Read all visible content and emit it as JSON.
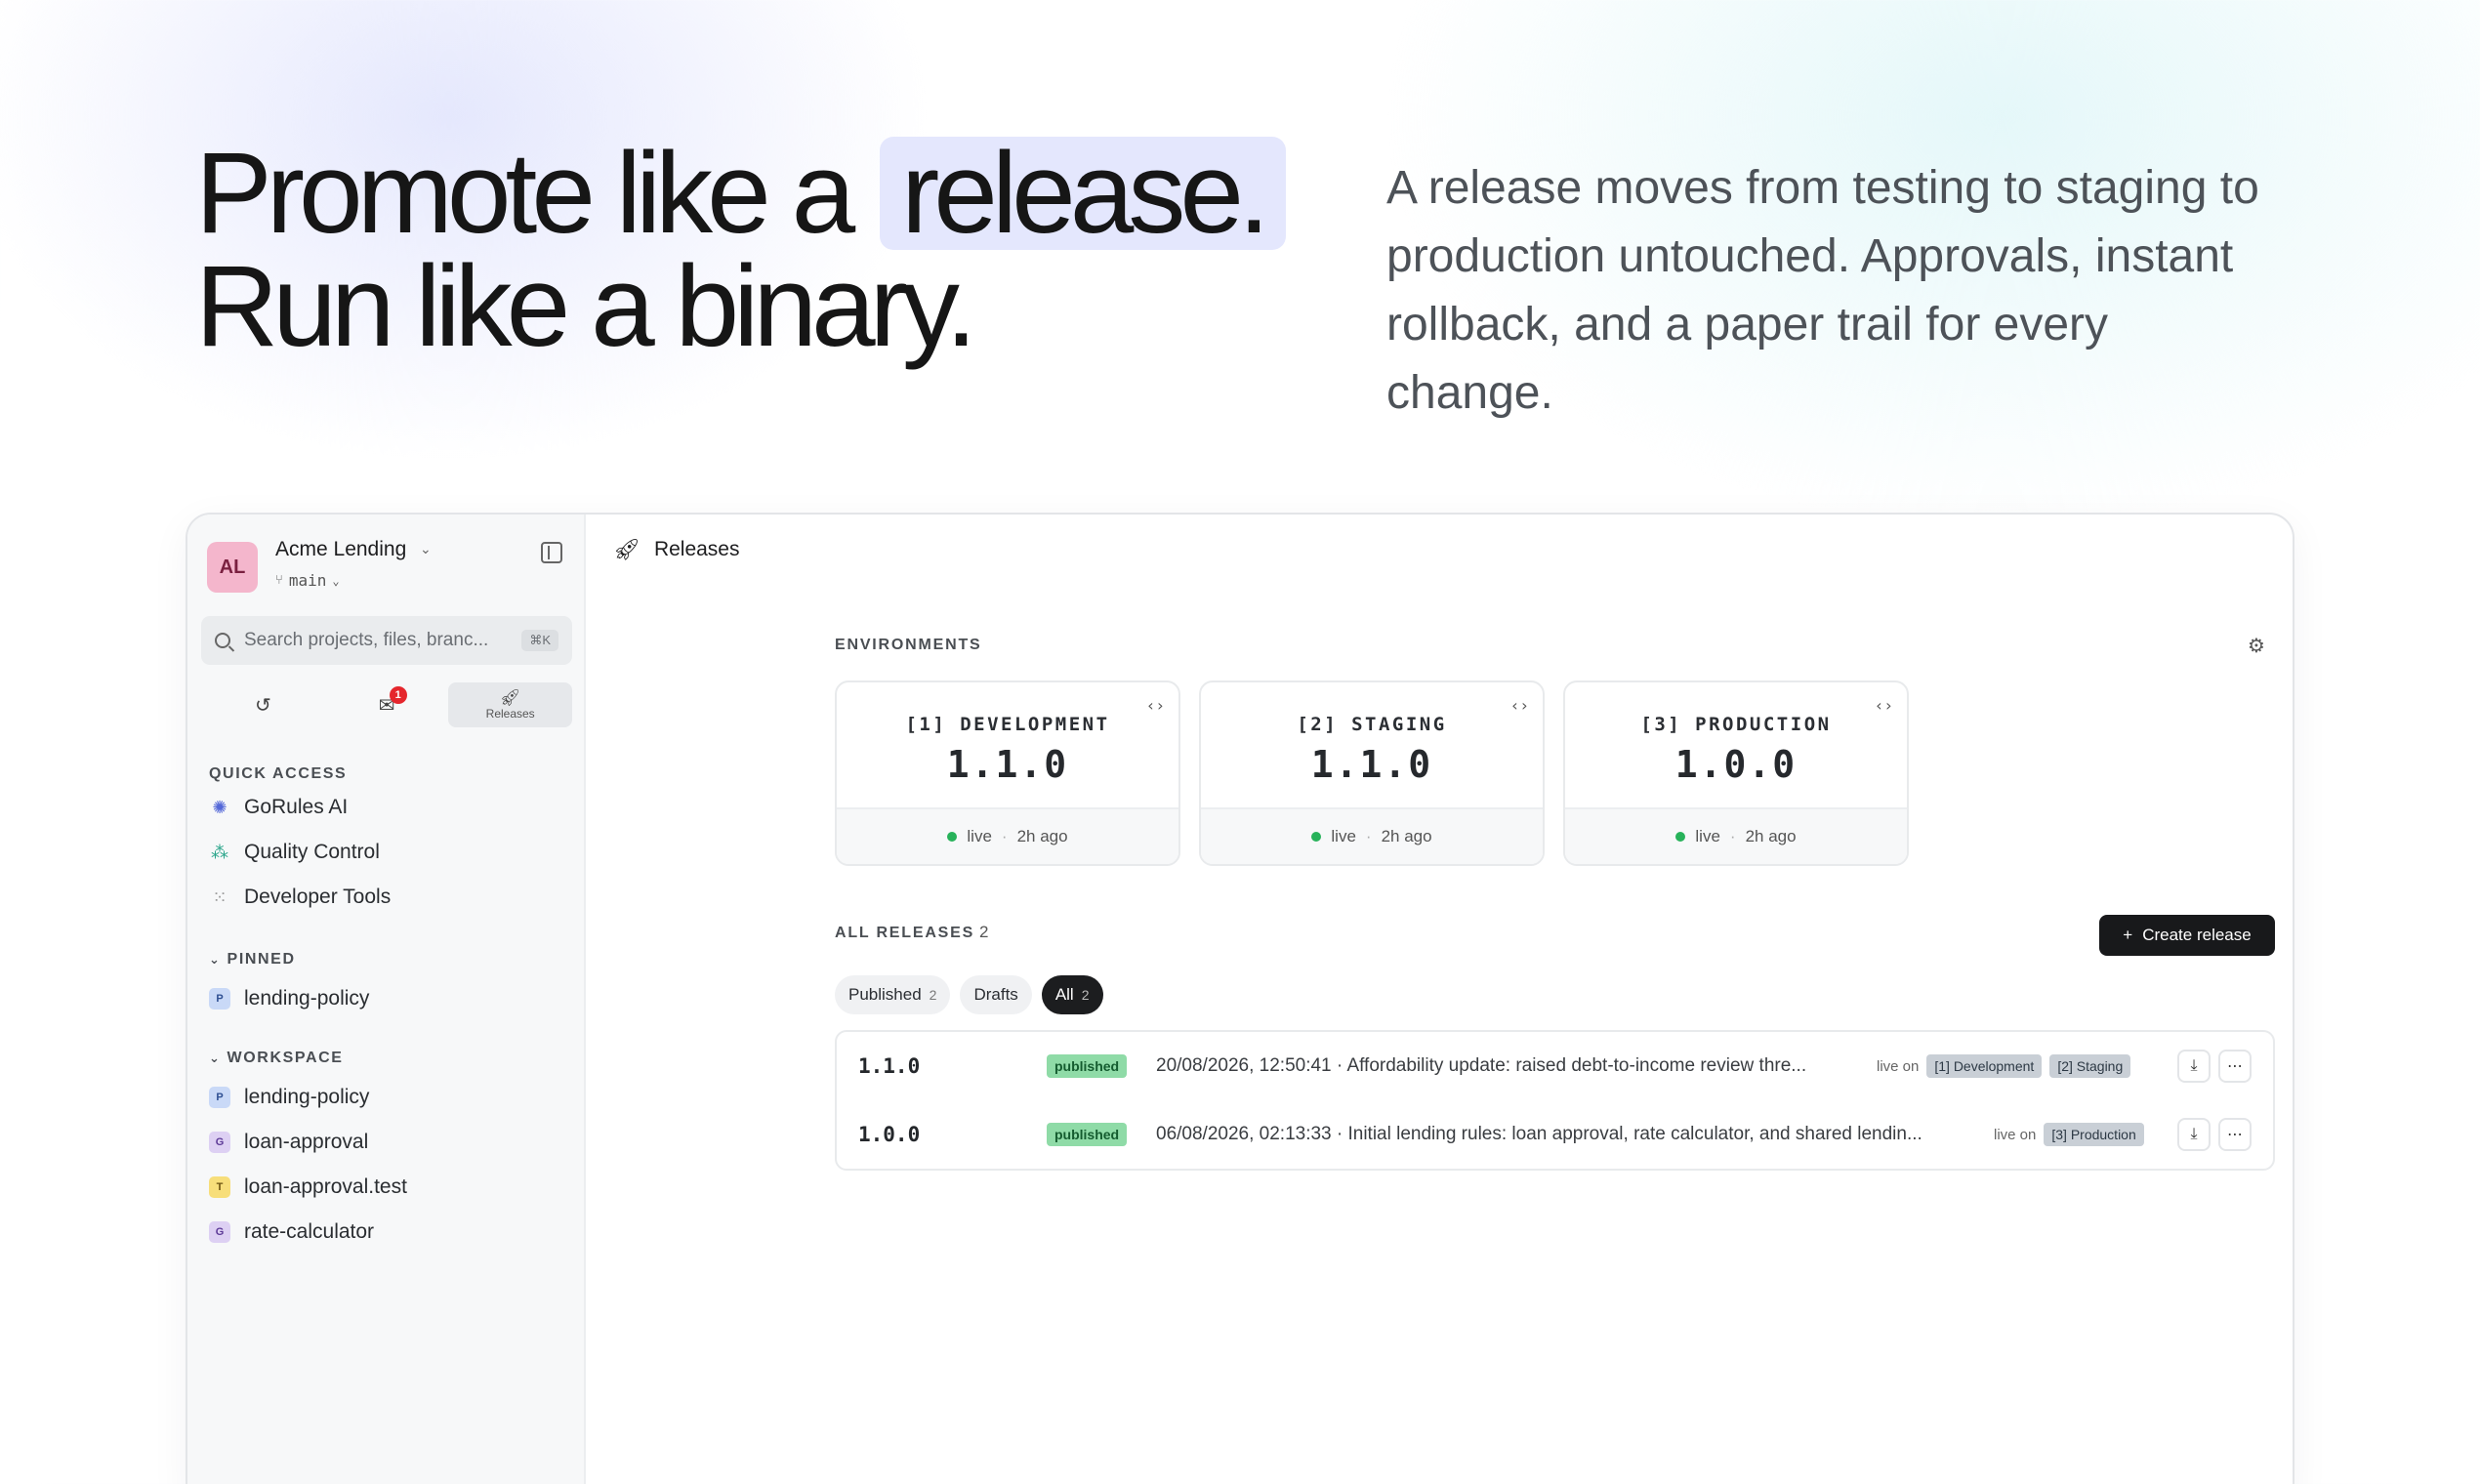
{
  "hero": {
    "title_line1_pre": "Promote like a",
    "title_line1_highlight": "release.",
    "title_line2": "Run like a binary.",
    "subtitle": "A release moves from testing to staging to production untouched. Approvals, instant rollback, and a paper trail for every change."
  },
  "sidebar": {
    "avatar": "AL",
    "org_name": "Acme Lending",
    "branch": "main",
    "search_placeholder": "Search projects, files, branc...",
    "search_shortcut": "⌘K",
    "notification_count": "1",
    "releases_tab_label": "Releases",
    "quick_access_title": "QUICK ACCESS",
    "quick_access": [
      "GoRules AI",
      "Quality Control",
      "Developer Tools"
    ],
    "pinned_title": "PINNED",
    "pinned": [
      {
        "chip": "P",
        "label": "lending-policy"
      }
    ],
    "workspace_title": "WORKSPACE",
    "workspace": [
      {
        "chip": "P",
        "label": "lending-policy"
      },
      {
        "chip": "G",
        "label": "loan-approval"
      },
      {
        "chip": "T",
        "label": "loan-approval.test"
      },
      {
        "chip": "G",
        "label": "rate-calculator"
      }
    ]
  },
  "main": {
    "page_title": "Releases",
    "environments_title": "ENVIRONMENTS",
    "environments": [
      {
        "name": "[1] DEVELOPMENT",
        "version": "1.1.0",
        "status": "live",
        "time": "2h ago"
      },
      {
        "name": "[2] STAGING",
        "version": "1.1.0",
        "status": "live",
        "time": "2h ago"
      },
      {
        "name": "[3] PRODUCTION",
        "version": "1.0.0",
        "status": "live",
        "time": "2h ago"
      }
    ],
    "all_releases_title": "ALL RELEASES",
    "all_releases_count": "2",
    "create_label": "Create release",
    "filters": [
      {
        "label": "Published",
        "count": "2"
      },
      {
        "label": "Drafts",
        "count": ""
      },
      {
        "label": "All",
        "count": "2"
      }
    ],
    "releases": [
      {
        "version": "1.1.0",
        "status": "published",
        "description": "20/08/2026, 12:50:41 · Affordability update: raised debt-to-income review thre...",
        "live_on_label": "live on",
        "envs": [
          "[1] Development",
          "[2] Staging"
        ]
      },
      {
        "version": "1.0.0",
        "status": "published",
        "description": "06/08/2026, 02:13:33 · Initial lending rules: loan approval, rate calculator, and shared lendin...",
        "live_on_label": "live on",
        "envs": [
          "[3] Production"
        ]
      }
    ]
  }
}
